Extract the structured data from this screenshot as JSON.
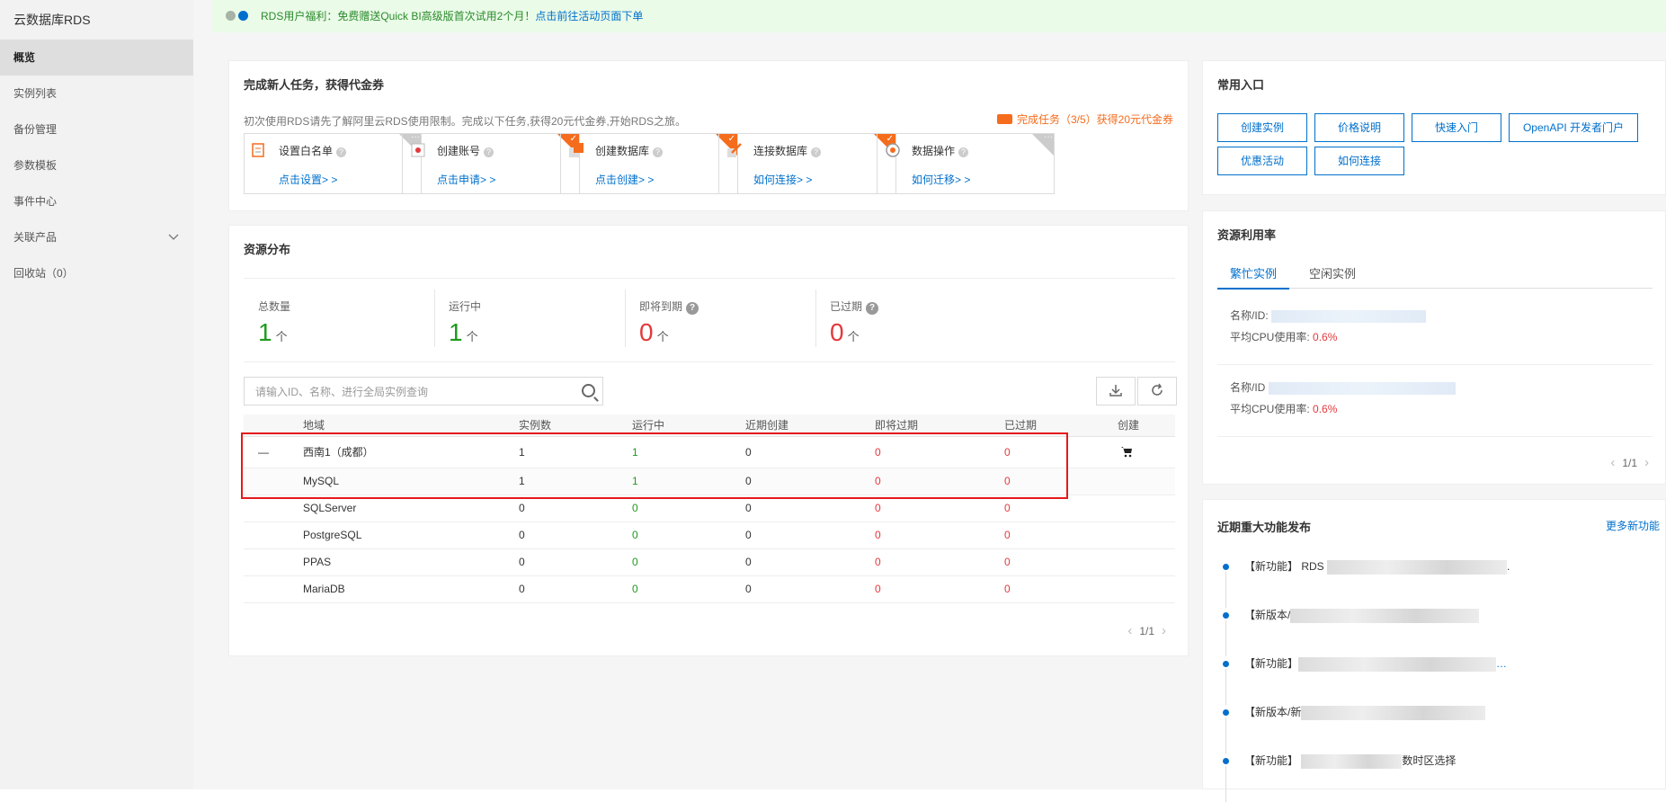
{
  "sidebar": {
    "title": "云数据库RDS",
    "items": [
      {
        "label": "概览"
      },
      {
        "label": "实例列表"
      },
      {
        "label": "备份管理"
      },
      {
        "label": "参数模板"
      },
      {
        "label": "事件中心"
      },
      {
        "label": "关联产品"
      },
      {
        "label": "回收站（0）"
      }
    ]
  },
  "notice": {
    "text": "RDS用户福利：免费赠送Quick BI高级版首次试用2个月！",
    "link": "点击前往活动页面下单",
    "dot_colors": [
      "#a7b3a7",
      "#0070cc"
    ]
  },
  "tasks": {
    "title": "完成新人任务，获得代金券",
    "subtitle": "初次使用RDS请先了解阿里云RDS使用限制。完成以下任务,获得20元代金券,开始RDS之旅。",
    "progress": "完成任务（3/5）获得20元代金券",
    "items": [
      {
        "title": "设置白名单",
        "link": "点击设置> >",
        "done": false,
        "icon": "whitelist-icon"
      },
      {
        "title": "创建账号",
        "link": "点击申请> >",
        "done": true,
        "icon": "account-icon"
      },
      {
        "title": "创建数据库",
        "link": "点击创建> >",
        "done": true,
        "icon": "database-icon"
      },
      {
        "title": "连接数据库",
        "link": "如何连接> >",
        "done": true,
        "icon": "connect-icon"
      },
      {
        "title": "数据操作",
        "link": "如何迁移> >",
        "done": false,
        "icon": "data-op-icon"
      }
    ]
  },
  "resources": {
    "title": "资源分布",
    "stats": [
      {
        "label": "总数量",
        "value": "1",
        "unit": "个",
        "color": "#1e9a1e"
      },
      {
        "label": "运行中",
        "value": "1",
        "unit": "个",
        "color": "#1e9a1e"
      },
      {
        "label": "即将到期",
        "value": "0",
        "unit": "个",
        "color": "#e4393c"
      },
      {
        "label": "已过期",
        "value": "0",
        "unit": "个",
        "color": "#e4393c"
      }
    ],
    "search_placeholder": "请输入ID、名称、进行全局实例查询",
    "columns": [
      "地域",
      "实例数",
      "运行中",
      "近期创建",
      "即将过期",
      "已过期",
      "创建"
    ],
    "region_row": {
      "expand": "—",
      "name": "西南1（成都）",
      "count": "1",
      "running": "1",
      "recent": "0",
      "expiring": "0",
      "expired": "0"
    },
    "engine_rows": [
      {
        "name": "MySQL",
        "count": "1",
        "running": "1",
        "recent": "0",
        "expiring": "0",
        "expired": "0"
      },
      {
        "name": "SQLServer",
        "count": "0",
        "running": "0",
        "recent": "0",
        "expiring": "0",
        "expired": "0"
      },
      {
        "name": "PostgreSQL",
        "count": "0",
        "running": "0",
        "recent": "0",
        "expiring": "0",
        "expired": "0"
      },
      {
        "name": "PPAS",
        "count": "0",
        "running": "0",
        "recent": "0",
        "expiring": "0",
        "expired": "0"
      },
      {
        "name": "MariaDB",
        "count": "0",
        "running": "0",
        "recent": "0",
        "expiring": "0",
        "expired": "0"
      }
    ],
    "pager": "1/1"
  },
  "quick": {
    "title": "常用入口",
    "buttons": [
      "创建实例",
      "价格说明",
      "快速入门",
      "OpenAPI 开发者门户",
      "优惠活动",
      "如何连接"
    ]
  },
  "util": {
    "title": "资源利用率",
    "tabs": [
      "繁忙实例",
      "空闲实例"
    ],
    "rows": [
      {
        "name_label": "名称/ID:",
        "cpu_label": "平均CPU使用率:",
        "cpu": "0.6%"
      },
      {
        "name_label": "名称/ID",
        "cpu_label": "平均CPU使用率:",
        "cpu": "0.6%"
      }
    ],
    "pager": "1/1"
  },
  "features": {
    "title": "近期重大功能发布",
    "more": "更多新功能",
    "items": [
      {
        "prefix": "【新功能】 RDS",
        "suffix": "."
      },
      {
        "prefix": "【新版本/",
        "suffix": ""
      },
      {
        "prefix": "【新功能】",
        "suffix": "…"
      },
      {
        "prefix": "【新版本/新",
        "suffix": ""
      },
      {
        "prefix": "【新功能】",
        "suffix": "数时区选择"
      }
    ]
  }
}
